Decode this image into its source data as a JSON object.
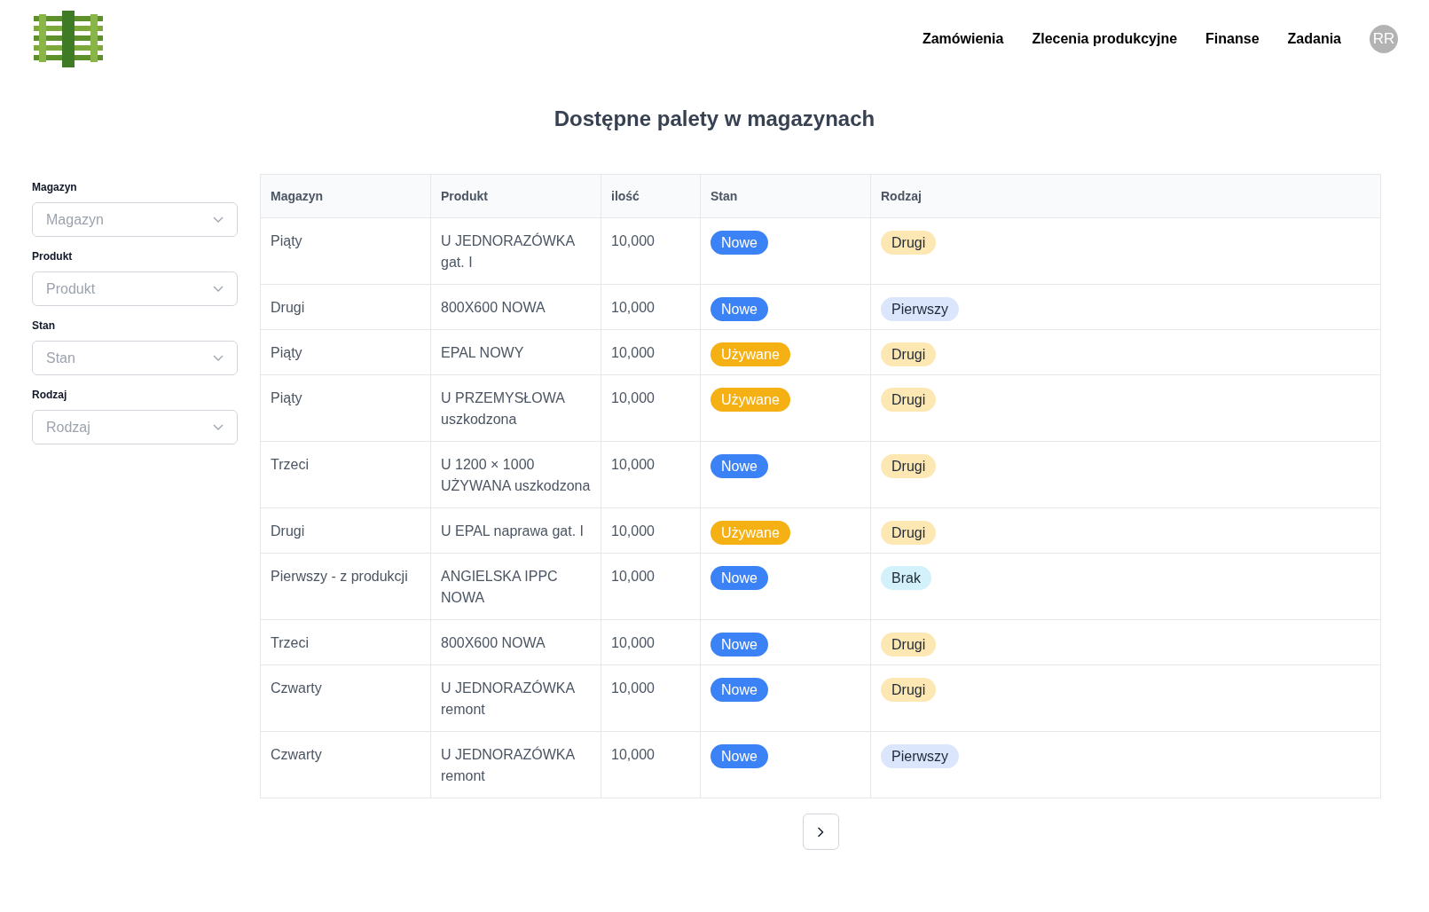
{
  "nav": {
    "links": [
      "Zamówienia",
      "Zlecenia produkcyjne",
      "Finanse",
      "Zadania"
    ],
    "avatar": "RR"
  },
  "title": "Dostępne palety w magazynach",
  "filters": [
    {
      "label": "Magazyn",
      "placeholder": "Magazyn"
    },
    {
      "label": "Produkt",
      "placeholder": "Produkt"
    },
    {
      "label": "Stan",
      "placeholder": "Stan"
    },
    {
      "label": "Rodzaj",
      "placeholder": "Rodzaj"
    }
  ],
  "table": {
    "columns": [
      "Magazyn",
      "Produkt",
      "ilość",
      "Stan",
      "Rodzaj"
    ],
    "rows": [
      {
        "magazyn": "Piąty",
        "produkt": "U JEDNORAZÓWKA gat. I",
        "ilosc": "10,000",
        "stan": {
          "label": "Nowe",
          "color": "#3b82f6"
        },
        "rodzaj": {
          "label": "Drugi",
          "color": "#fde8b4"
        }
      },
      {
        "magazyn": "Drugi",
        "produkt": "800X600 NOWA",
        "ilosc": "10,000",
        "stan": {
          "label": "Nowe",
          "color": "#3b82f6"
        },
        "rodzaj": {
          "label": "Pierwszy",
          "color": "#dbe6fd"
        }
      },
      {
        "magazyn": "Piąty",
        "produkt": "EPAL NOWY",
        "ilosc": "10,000",
        "stan": {
          "label": "Używane",
          "color": "#f5b014"
        },
        "rodzaj": {
          "label": "Drugi",
          "color": "#fde8b4"
        }
      },
      {
        "magazyn": "Piąty",
        "produkt": "U PRZEMYSŁOWA uszkodzona",
        "ilosc": "10,000",
        "stan": {
          "label": "Używane",
          "color": "#f5b014"
        },
        "rodzaj": {
          "label": "Drugi",
          "color": "#fde8b4"
        }
      },
      {
        "magazyn": "Trzeci",
        "produkt": "U 1200 × 1000 UŻYWANA uszkodzona",
        "ilosc": "10,000",
        "stan": {
          "label": "Nowe",
          "color": "#3b82f6"
        },
        "rodzaj": {
          "label": "Drugi",
          "color": "#fde8b4"
        }
      },
      {
        "magazyn": "Drugi",
        "produkt": "U EPAL naprawa gat. I",
        "ilosc": "10,000",
        "stan": {
          "label": "Używane",
          "color": "#f5b014"
        },
        "rodzaj": {
          "label": "Drugi",
          "color": "#fde8b4"
        }
      },
      {
        "magazyn": "Pierwszy - z produkcji",
        "produkt": "ANGIELSKA IPPC NOWA",
        "ilosc": "10,000",
        "stan": {
          "label": "Nowe",
          "color": "#3b82f6"
        },
        "rodzaj": {
          "label": "Brak",
          "color": "#d3f1fa"
        }
      },
      {
        "magazyn": "Trzeci",
        "produkt": "800X600 NOWA",
        "ilosc": "10,000",
        "stan": {
          "label": "Nowe",
          "color": "#3b82f6"
        },
        "rodzaj": {
          "label": "Drugi",
          "color": "#fde8b4"
        }
      },
      {
        "magazyn": "Czwarty",
        "produkt": "U JEDNORAZÓWKA remont",
        "ilosc": "10,000",
        "stan": {
          "label": "Nowe",
          "color": "#3b82f6"
        },
        "rodzaj": {
          "label": "Drugi",
          "color": "#fde8b4"
        }
      },
      {
        "magazyn": "Czwarty",
        "produkt": "U JEDNORAZÓWKA remont",
        "ilosc": "10,000",
        "stan": {
          "label": "Nowe",
          "color": "#3b82f6"
        },
        "rodzaj": {
          "label": "Pierwszy",
          "color": "#dbe6fd"
        }
      }
    ]
  }
}
